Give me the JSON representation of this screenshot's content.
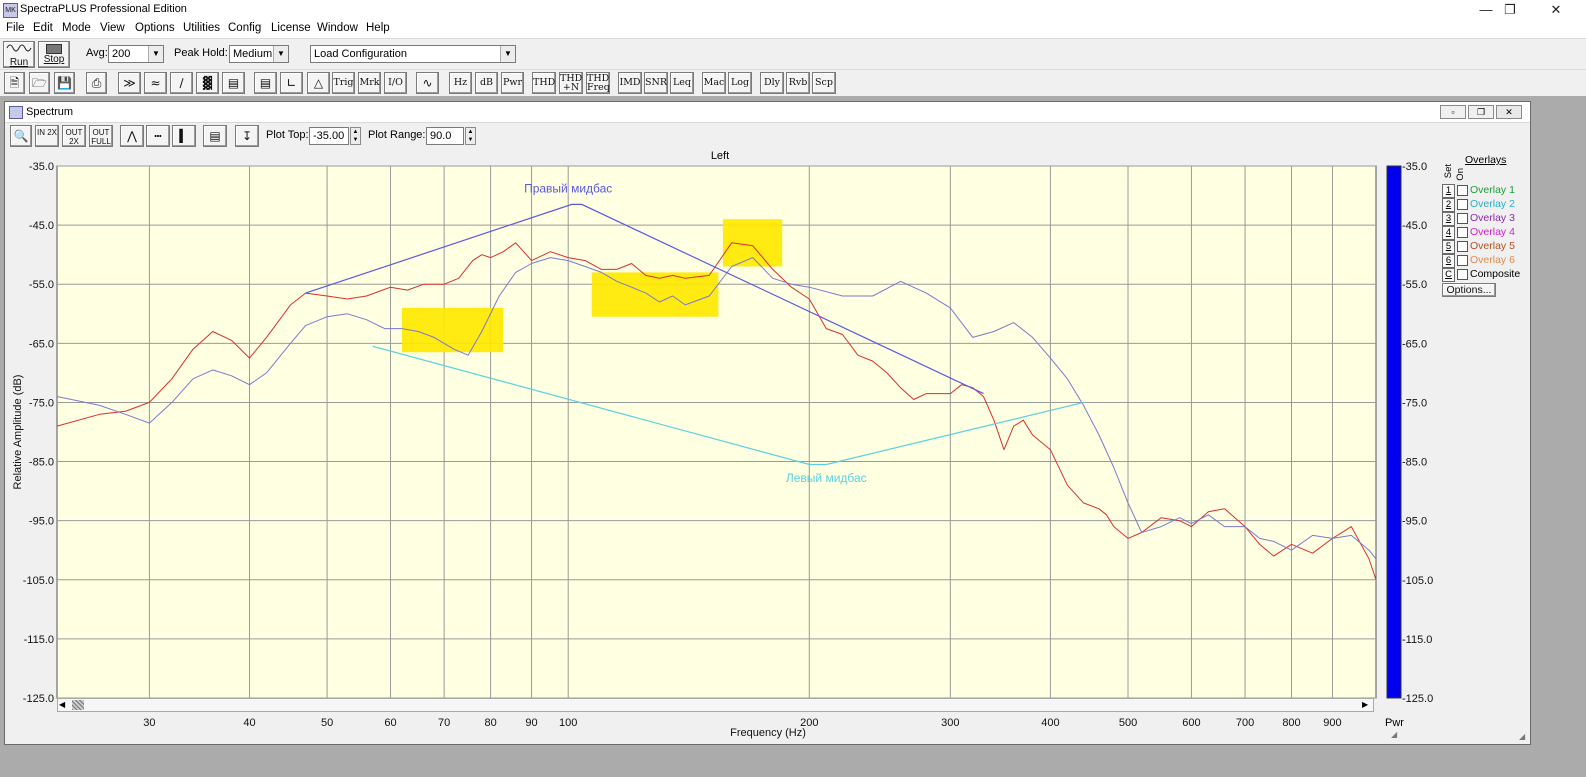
{
  "app": {
    "title": "SpectraPLUS Professional Edition",
    "icon_text": "MK",
    "controls": [
      "minimize-icon",
      "restore-icon",
      "close-icon"
    ]
  },
  "menu": [
    "File",
    "Edit",
    "Mode",
    "View",
    "Options",
    "Utilities",
    "Config",
    "License",
    "Window",
    "Help"
  ],
  "toolbar1": {
    "run_label": "Run",
    "stop_label": "Stop",
    "avg_label": "Avg:",
    "avg_value": "200",
    "peak_hold_label": "Peak Hold:",
    "peak_hold_value": "Medium",
    "config_value": "Load Configuration"
  },
  "toolbar2": {
    "icon_buttons": [
      "new-file-icon",
      "open-folder-icon",
      "save-icon",
      "print-icon",
      "waveform-icon",
      "spectrum-icon",
      "phase-icon",
      "spectrogram-icon",
      "3d-surface-icon",
      "report-icon",
      "axis-icon",
      "transducer-icon"
    ],
    "text_buttons_a": [
      "Trig",
      "Mrk",
      "I/O"
    ],
    "text_buttons_b": [
      "Hz",
      "dB",
      "Pwr"
    ],
    "text_buttons_c": [
      "THD",
      "THD +N",
      "THD Freq"
    ],
    "text_buttons_d": [
      "IMD",
      "SNR",
      "Leq"
    ],
    "text_buttons_e": [
      "Mac",
      "Log"
    ],
    "text_buttons_f": [
      "Dly",
      "Rvb",
      "Scp"
    ]
  },
  "spectrum_window": {
    "title": "Spectrum",
    "zoom_buttons": [
      "IN 2X",
      "OUT 2X",
      "OUT FULL"
    ],
    "plot_top_label": "Plot Top:",
    "plot_top_value": "-35.00",
    "plot_range_label": "Plot Range:",
    "plot_range_value": "90.0",
    "channel_label": "Left",
    "meter_label": "Pwr",
    "overlays": {
      "header": "Overlays",
      "set_label": "Set",
      "on_label": "On",
      "items": [
        {
          "num": "1",
          "label": "Overlay 1",
          "color": "#1e9a3c"
        },
        {
          "num": "2",
          "label": "Overlay 2",
          "color": "#26b0c8"
        },
        {
          "num": "3",
          "label": "Overlay 3",
          "color": "#8a2ab0"
        },
        {
          "num": "4",
          "label": "Overlay 4",
          "color": "#d020d0"
        },
        {
          "num": "5",
          "label": "Overlay 5",
          "color": "#b0501e"
        },
        {
          "num": "6",
          "label": "Overlay 6",
          "color": "#e08a50"
        },
        {
          "num": "C",
          "label": "Composite",
          "color": "#000000"
        }
      ],
      "options_label": "Options..."
    }
  },
  "chart_data": {
    "type": "line",
    "xscale": "log",
    "xlabel": "Frequency (Hz)",
    "ylabel": "Relative Amplitude (dB)",
    "xlim": [
      23,
      1020
    ],
    "ylim": [
      -125,
      -35
    ],
    "x_tick_labels": [
      "30",
      "40",
      "50",
      "60",
      "70",
      "80",
      "90",
      "100",
      "200",
      "300",
      "400",
      "500",
      "600",
      "700",
      "800",
      "900"
    ],
    "x_tick_values": [
      30,
      40,
      50,
      60,
      70,
      80,
      90,
      100,
      200,
      300,
      400,
      500,
      600,
      700,
      800,
      900
    ],
    "y_ticks": [
      "-35.0",
      "-45.0",
      "-55.0",
      "-65.0",
      "-75.0",
      "-85.0",
      "-95.0",
      "-105.0",
      "-115.0",
      "-125.0"
    ],
    "y_tick_values": [
      -35,
      -45,
      -55,
      -65,
      -75,
      -85,
      -95,
      -105,
      -115,
      -125
    ],
    "grid": true,
    "plot_bg": "#ffffe1",
    "series": [
      {
        "color": "#d83030",
        "x": [
          23,
          26,
          28,
          30,
          32,
          34,
          36,
          38,
          40,
          42,
          45,
          47,
          50,
          53,
          56,
          60,
          63,
          66,
          70,
          73,
          76,
          78,
          80,
          83,
          86,
          90,
          95,
          100,
          105,
          110,
          115,
          120,
          125,
          130,
          135,
          140,
          150,
          160,
          170,
          180,
          190,
          200,
          210,
          220,
          230,
          240,
          250,
          260,
          270,
          280,
          290,
          300,
          310,
          320,
          330,
          340,
          350,
          360,
          370,
          380,
          400,
          420,
          440,
          460,
          470,
          480,
          500,
          520,
          550,
          580,
          600,
          630,
          660,
          700,
          730,
          760,
          800,
          850,
          900,
          950,
          1000,
          1020
        ],
        "y": [
          -79,
          -77,
          -76.5,
          -75,
          -71,
          -66,
          -63,
          -64.5,
          -67.5,
          -64,
          -58.5,
          -56.5,
          -57,
          -57.5,
          -57,
          -55.5,
          -56,
          -55,
          -55,
          -54,
          -51,
          -50,
          -50.5,
          -49.5,
          -48,
          -51,
          -49.5,
          -50.5,
          -51,
          -52.5,
          -52.5,
          -51.5,
          -53.5,
          -54,
          -53.5,
          -54,
          -53.5,
          -48,
          -48.5,
          -52.5,
          -55.5,
          -57.5,
          -62.5,
          -63.5,
          -67,
          -68,
          -70,
          -72.5,
          -74.5,
          -73.5,
          -73.5,
          -73.5,
          -72,
          -72.5,
          -74,
          -78,
          -83,
          -79,
          -78,
          -80.5,
          -83,
          -89,
          -92,
          -93,
          -94,
          -96,
          -98,
          -97,
          -94.5,
          -95,
          -96,
          -93.5,
          -93,
          -96,
          -99,
          -101,
          -99,
          -100.5,
          -98,
          -96,
          -101.5,
          -105
        ]
      },
      {
        "color": "#7a7ad0",
        "x": [
          23,
          26,
          28,
          30,
          32,
          34,
          36,
          38,
          40,
          42,
          45,
          47,
          50,
          53,
          56,
          59,
          62,
          65,
          68,
          72,
          75,
          78,
          82,
          86,
          90,
          95,
          100,
          105,
          110,
          115,
          120,
          125,
          130,
          135,
          140,
          150,
          160,
          170,
          180,
          190,
          200,
          220,
          240,
          260,
          280,
          300,
          320,
          340,
          360,
          380,
          400,
          420,
          440,
          460,
          480,
          500,
          520,
          550,
          580,
          600,
          630,
          660,
          700,
          730,
          760,
          800,
          850,
          900,
          950,
          1000,
          1020
        ],
        "y": [
          -74,
          -75.5,
          -77,
          -78.5,
          -75,
          -71,
          -69.5,
          -70.5,
          -72,
          -70,
          -65,
          -62,
          -60.5,
          -60,
          -61,
          -62.5,
          -62.5,
          -63,
          -64,
          -66,
          -67,
          -63,
          -57,
          -53,
          -51.5,
          -50.5,
          -51,
          -52,
          -53,
          -54.5,
          -55.5,
          -56.5,
          -58,
          -57,
          -58.5,
          -57,
          -52,
          -50.5,
          -54,
          -55,
          -55.5,
          -57,
          -57,
          -54.5,
          -56.5,
          -59,
          -64,
          -63,
          -61.5,
          -64,
          -67.5,
          -71,
          -75.5,
          -80.5,
          -86,
          -92,
          -97,
          -96,
          -94.5,
          -95.5,
          -94,
          -96,
          -96,
          -98,
          -98.5,
          -100,
          -97.5,
          -98,
          -97.5,
          -100,
          -101.5
        ]
      }
    ],
    "annotations": {
      "highlights": [
        {
          "x": [
            62,
            83
          ],
          "y": [
            -59,
            -66.5
          ]
        },
        {
          "x": [
            107,
            154
          ],
          "y": [
            -53,
            -60.5
          ]
        },
        {
          "x": [
            156,
            185
          ],
          "y": [
            -44,
            -52
          ]
        }
      ],
      "right_midbass": {
        "label": "Правый мидбас",
        "color": "#5a5ae0",
        "points": [
          [
            47,
            -56.5
          ],
          [
            101,
            -41.5
          ],
          [
            104,
            -41.5
          ],
          [
            330,
            -73.5
          ]
        ],
        "label_at": [
          100,
          -39.5
        ]
      },
      "left_midbass": {
        "label": "Левый мидбас",
        "color": "#5ad0e0",
        "points": [
          [
            57,
            -65.5
          ],
          [
            200,
            -85.5
          ],
          [
            210,
            -85.5
          ],
          [
            440,
            -75
          ]
        ],
        "label_at": [
          210,
          -88.5
        ]
      }
    }
  }
}
